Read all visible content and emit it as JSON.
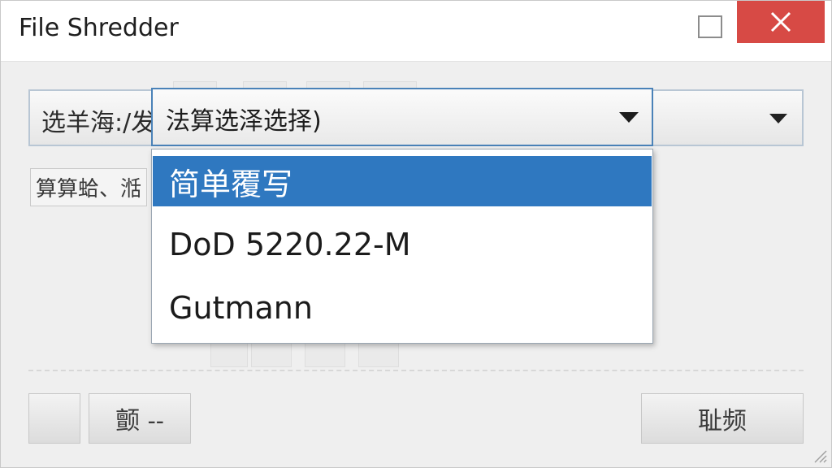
{
  "window": {
    "title": "File Shredder"
  },
  "mode_select": {
    "label": "选羊海:/发",
    "arrow_icon": "chevron-down-icon"
  },
  "algorithm_select": {
    "value": "法算选泽选择)",
    "arrow_icon": "chevron-down-icon"
  },
  "algorithm_options": [
    {
      "label": "简单覆写",
      "selected": true
    },
    {
      "label": "DoD 5220.22-M",
      "selected": false
    },
    {
      "label": "Gutmann",
      "selected": false
    }
  ],
  "side_label": "算算蛤、湉",
  "buttons": {
    "bottom_left_blank": "",
    "options_button": "颤 --",
    "confirm_button": "耻频"
  },
  "colors": {
    "selected_bg": "#2f78c0",
    "close_bg": "#d74a45",
    "focus_border": "#4a82b8"
  }
}
